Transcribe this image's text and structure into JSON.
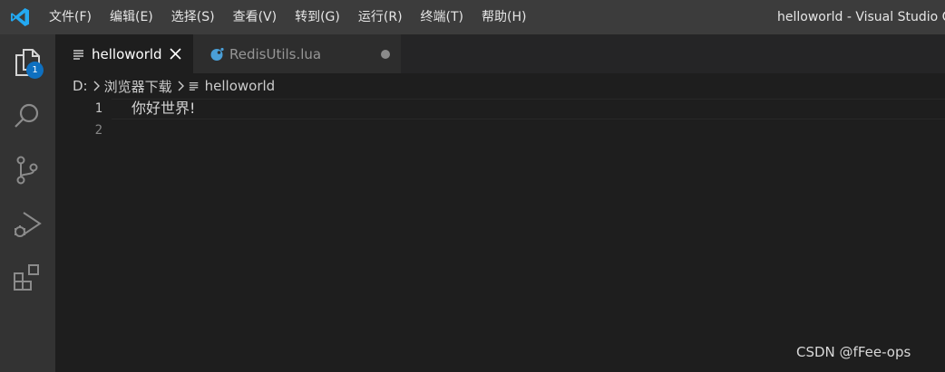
{
  "titlebar": {
    "menu": [
      "文件(F)",
      "编辑(E)",
      "选择(S)",
      "查看(V)",
      "转到(G)",
      "运行(R)",
      "终端(T)",
      "帮助(H)"
    ],
    "window_title": "helloworld - Visual Studio Co"
  },
  "activitybar": {
    "icons": [
      "explorer-icon",
      "search-icon",
      "source-control-icon",
      "run-debug-icon",
      "extensions-icon"
    ],
    "explorer_badge": "1"
  },
  "tabs": [
    {
      "label": "helloworld",
      "icon": "text-file-icon",
      "state": "active"
    },
    {
      "label": "RedisUtils.lua",
      "icon": "lua-file-icon",
      "state": "modified"
    }
  ],
  "breadcrumb": {
    "drive": "D:",
    "folder": "浏览器下载",
    "file": "helloworld"
  },
  "editor": {
    "lines": [
      {
        "number": "1",
        "text": "你好世界!"
      },
      {
        "number": "2",
        "text": ""
      }
    ]
  },
  "watermark": "CSDN @fFee-ops",
  "colors": {
    "titlebar": "#3c3c3c",
    "activitybar": "#333333",
    "editor": "#1e1e1e",
    "badge": "#0e70c0",
    "vscode_blue": "#23a9f2"
  }
}
